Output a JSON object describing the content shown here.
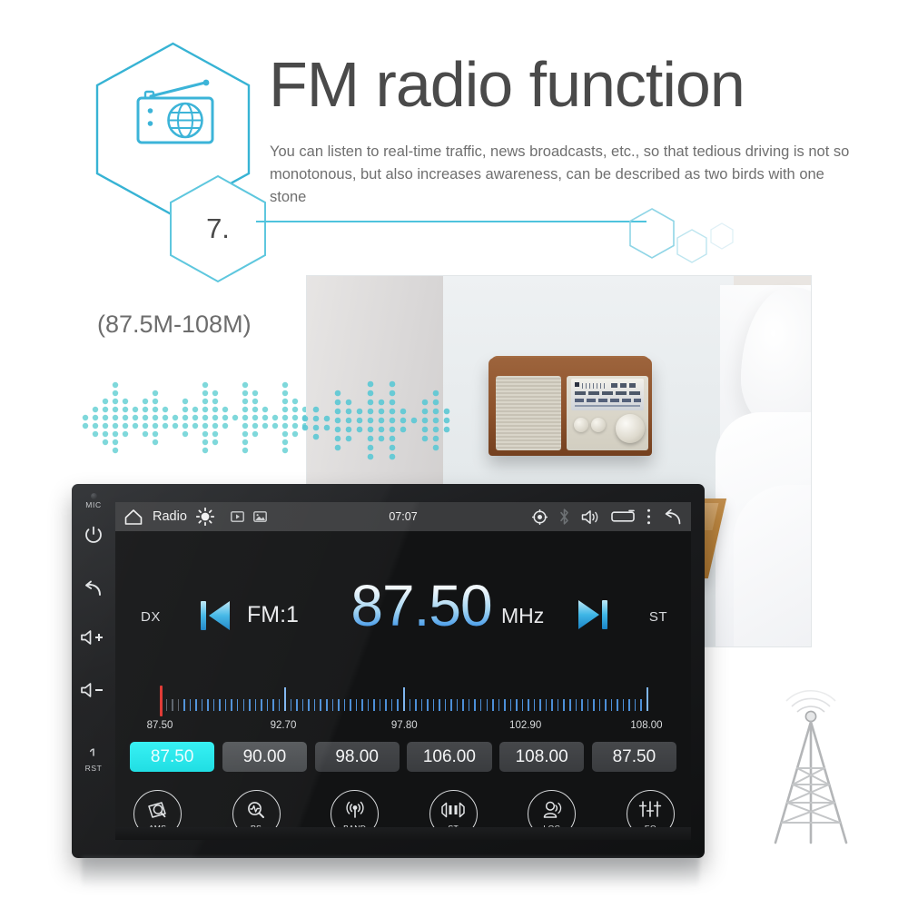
{
  "header": {
    "step_number": "7.",
    "title": "FM radio function",
    "subtitle": "You can listen to real-time traffic, news broadcasts, etc., so that tedious driving is not so monotonous, but also increases awareness, can be described as two birds with one stone",
    "icon": "radio-icon",
    "accent_color": "#4fc3dd"
  },
  "range_note": {
    "text": "(87.5M-108M)"
  },
  "device": {
    "bezel": [
      {
        "name": "mic",
        "label": "MIC",
        "glyph": ""
      },
      {
        "name": "power",
        "label": "",
        "glyph": "⏻"
      },
      {
        "name": "back",
        "label": "",
        "glyph": "↩"
      },
      {
        "name": "volume-up",
        "label": "",
        "glyph": "+"
      },
      {
        "name": "volume-down",
        "label": "",
        "glyph": "−"
      },
      {
        "name": "reset",
        "label": "RST",
        "glyph": ""
      }
    ],
    "statusbar": {
      "home_icon": "home-icon",
      "app_label": "Radio",
      "brightness_icon": "brightness-icon",
      "video_icon": "video-icon",
      "image_icon": "image-icon",
      "clock": "07:07",
      "gps_icon": "gps-icon",
      "bluetooth_icon": "bluetooth-icon",
      "volume_icon": "volume-icon",
      "recents_icon": "recents-icon",
      "menu_icon": "more-vert-icon",
      "back_icon": "back-arrow-icon"
    },
    "tuner": {
      "dx_label": "DX",
      "st_label": "ST",
      "band_label": "FM:1",
      "frequency": "87.50",
      "unit": "MHz",
      "prev_icon": "skip-previous-icon",
      "next_icon": "skip-next-icon",
      "needle_color": "#e0332e",
      "active_color": "#22e4e8"
    },
    "scale": {
      "min": 87.5,
      "max": 108.0,
      "needle_value": 87.5,
      "labels": [
        "87.50",
        "92.70",
        "97.80",
        "102.90",
        "108.00"
      ]
    },
    "presets": [
      {
        "value": "87.50",
        "active": true
      },
      {
        "value": "90.00",
        "active": false
      },
      {
        "value": "98.00",
        "active": false
      },
      {
        "value": "106.00",
        "active": false
      },
      {
        "value": "108.00",
        "active": false
      },
      {
        "value": "87.50",
        "active": false
      }
    ],
    "functions": [
      {
        "label": "AMS",
        "icon": "ams-scan-icon"
      },
      {
        "label": "PS",
        "icon": "ps-search-icon"
      },
      {
        "label": "BAND",
        "icon": "band-antenna-icon"
      },
      {
        "label": "ST",
        "icon": "stereo-icon"
      },
      {
        "label": "LOC",
        "icon": "local-icon"
      },
      {
        "label": "EQ",
        "icon": "equalizer-icon"
      }
    ]
  },
  "tower": {
    "icon": "radio-tower-icon"
  }
}
